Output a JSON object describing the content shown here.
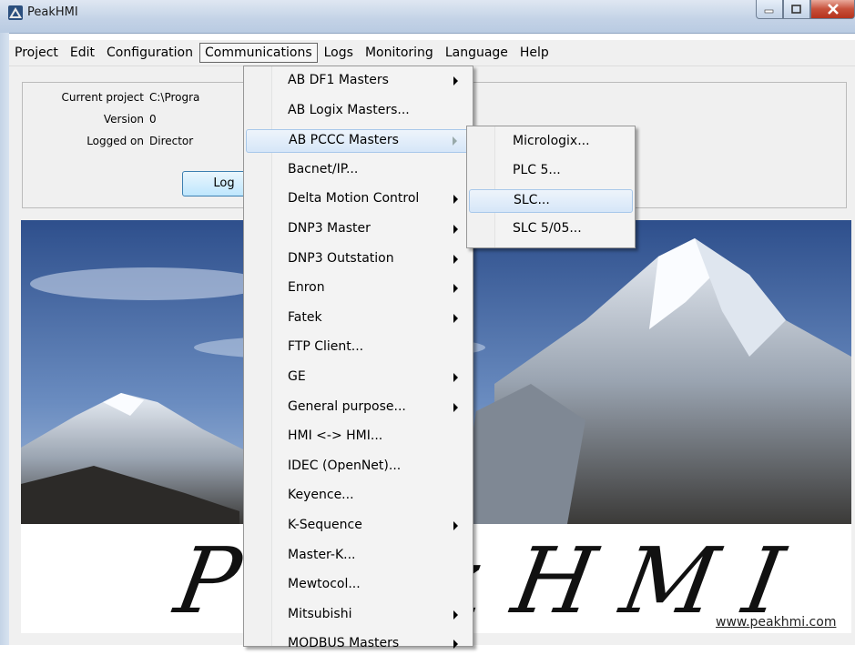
{
  "window": {
    "title": "PeakHMI"
  },
  "menubar": [
    "Project",
    "Edit",
    "Configuration",
    "Communications",
    "Logs",
    "Monitoring",
    "Language",
    "Help"
  ],
  "info": {
    "current_project_label": "Current project",
    "current_project_value": "C:\\Progra",
    "version_label": "Version",
    "version_value": "0",
    "logged_on_label": "Logged on",
    "logged_on_value": "Director",
    "login_button": "Log"
  },
  "comm_menu": [
    {
      "label": "AB DF1 Masters",
      "submenu": true
    },
    {
      "label": "AB Logix Masters...",
      "submenu": false
    },
    {
      "label": "AB PCCC Masters",
      "submenu": true
    },
    {
      "label": "Bacnet/IP...",
      "submenu": false
    },
    {
      "label": "Delta Motion Control",
      "submenu": true
    },
    {
      "label": "DNP3 Master",
      "submenu": true
    },
    {
      "label": "DNP3 Outstation",
      "submenu": true
    },
    {
      "label": "Enron",
      "submenu": true
    },
    {
      "label": "Fatek",
      "submenu": true
    },
    {
      "label": "FTP Client...",
      "submenu": false
    },
    {
      "label": "GE",
      "submenu": true
    },
    {
      "label": "General purpose...",
      "submenu": true
    },
    {
      "label": "HMI <-> HMI...",
      "submenu": false
    },
    {
      "label": "IDEC (OpenNet)...",
      "submenu": false
    },
    {
      "label": "Keyence...",
      "submenu": false
    },
    {
      "label": "K-Sequence",
      "submenu": true
    },
    {
      "label": "Master-K...",
      "submenu": false
    },
    {
      "label": "Mewtocol...",
      "submenu": false
    },
    {
      "label": "Mitsubishi",
      "submenu": true
    },
    {
      "label": "MODBUS Masters",
      "submenu": true
    }
  ],
  "pccc_submenu": [
    "Micrologix...",
    "PLC 5...",
    "SLC...",
    "SLC 5/05..."
  ],
  "logo": {
    "text": "PeakHMI",
    "website": "www.peakhmi.com"
  },
  "colors": {
    "highlight_border": "#a8c8ea",
    "titlebar": "#c3d2e6"
  }
}
